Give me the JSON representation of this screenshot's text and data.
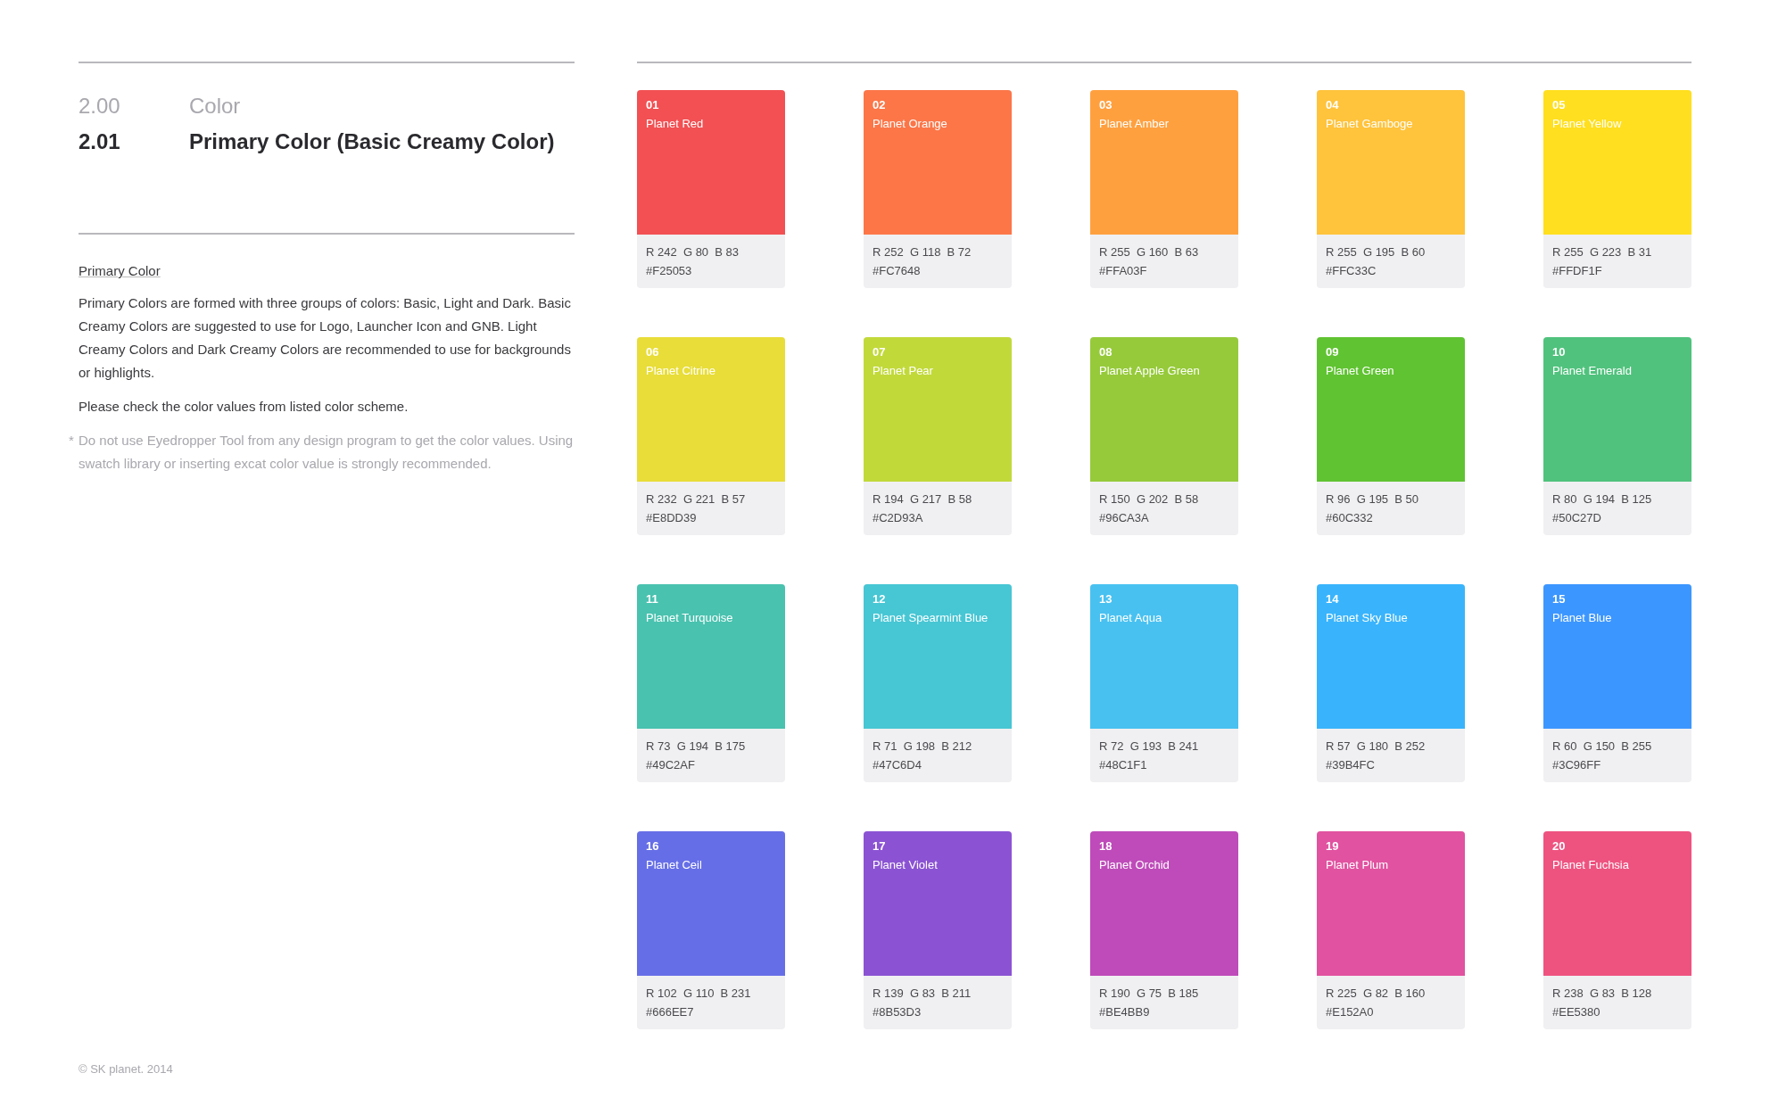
{
  "header": {
    "section_number": "2.00",
    "section_title": "Color",
    "subsection_number": "2.01",
    "subsection_title": "Primary Color (Basic Creamy Color)"
  },
  "body": {
    "heading": "Primary Color",
    "paragraph": "Primary Colors are formed with three groups of colors: Basic, Light and Dark. Basic Creamy Colors are suggested to use for Logo, Launcher Icon and GNB. Light Creamy Colors and Dark Creamy Colors are recommended to use for backgrounds or highlights.",
    "note": "Please check the color values from listed color scheme.",
    "footnote_mark": "*",
    "footnote": "Do not use Eyedropper Tool from any design program to get the color values. Using swatch library or inserting excat color value is strongly recommended."
  },
  "swatches": [
    {
      "number": "01",
      "name": "Planet Red",
      "rgb": "R 242  G 80  B 83",
      "hex": "#F25053",
      "color": "#f25053"
    },
    {
      "number": "02",
      "name": "Planet Orange",
      "rgb": "R 252  G 118  B 72",
      "hex": "#FC7648",
      "color": "#fc7648"
    },
    {
      "number": "03",
      "name": "Planet Amber",
      "rgb": "R 255  G 160  B 63",
      "hex": "#FFA03F",
      "color": "#ffa03f"
    },
    {
      "number": "04",
      "name": "Planet Gamboge",
      "rgb": "R 255  G 195  B 60",
      "hex": "#FFC33C",
      "color": "#ffc33c"
    },
    {
      "number": "05",
      "name": "Planet Yellow",
      "rgb": "R 255  G 223  B 31",
      "hex": "#FFDF1F",
      "color": "#ffdf1f"
    },
    {
      "number": "06",
      "name": "Planet Citrine",
      "rgb": "R 232  G 221  B 57",
      "hex": "#E8DD39",
      "color": "#e8dd39"
    },
    {
      "number": "07",
      "name": "Planet Pear",
      "rgb": "R 194  G 217  B 58",
      "hex": "#C2D93A",
      "color": "#c2d93a"
    },
    {
      "number": "08",
      "name": "Planet Apple Green",
      "rgb": "R 150  G 202  B 58",
      "hex": "#96CA3A",
      "color": "#96ca3a"
    },
    {
      "number": "09",
      "name": "Planet Green",
      "rgb": "R 96  G 195  B 50",
      "hex": "#60C332",
      "color": "#60c332"
    },
    {
      "number": "10",
      "name": "Planet Emerald",
      "rgb": "R 80  G 194  B 125",
      "hex": "#50C27D",
      "color": "#50c27d"
    },
    {
      "number": "11",
      "name": "Planet Turquoise",
      "rgb": "R 73  G 194  B 175",
      "hex": "#49C2AF",
      "color": "#49c2af"
    },
    {
      "number": "12",
      "name": "Planet Spearmint Blue",
      "rgb": "R 71  G 198  B 212",
      "hex": "#47C6D4",
      "color": "#47c6d4"
    },
    {
      "number": "13",
      "name": "Planet Aqua",
      "rgb": "R 72  G 193  B 241",
      "hex": "#48C1F1",
      "color": "#48c1f1"
    },
    {
      "number": "14",
      "name": "Planet Sky Blue",
      "rgb": "R 57  G 180  B 252",
      "hex": "#39B4FC",
      "color": "#39b4fc"
    },
    {
      "number": "15",
      "name": "Planet Blue",
      "rgb": "R 60  G 150  B 255",
      "hex": "#3C96FF",
      "color": "#3c96ff"
    },
    {
      "number": "16",
      "name": "Planet Ceil",
      "rgb": "R 102  G 110  B 231",
      "hex": "#666EE7",
      "color": "#666ee7"
    },
    {
      "number": "17",
      "name": "Planet Violet",
      "rgb": "R 139  G 83  B 211",
      "hex": "#8B53D3",
      "color": "#8b53d3"
    },
    {
      "number": "18",
      "name": "Planet Orchid",
      "rgb": "R 190  G 75  B 185",
      "hex": "#BE4BB9",
      "color": "#be4bb9"
    },
    {
      "number": "19",
      "name": "Planet Plum",
      "rgb": "R 225  G 82  B 160",
      "hex": "#E152A0",
      "color": "#e152a0"
    },
    {
      "number": "20",
      "name": "Planet Fuchsia",
      "rgb": "R 238  G 83  B 128",
      "hex": "#EE5380",
      "color": "#ee5380"
    }
  ],
  "footer": {
    "copyright": "© SK planet. 2014"
  }
}
